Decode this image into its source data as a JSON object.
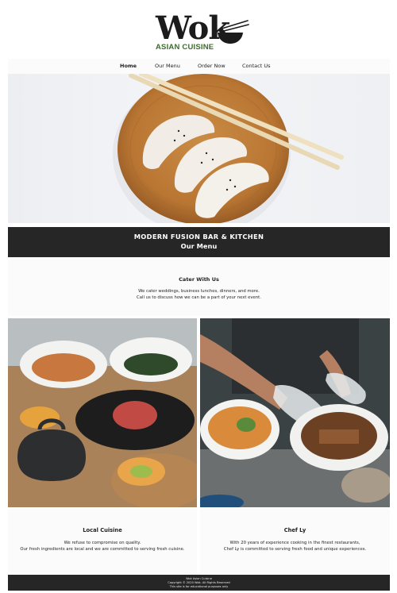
{
  "brand": {
    "name": "Wok",
    "tagline": "ASIAN CUISINE",
    "accent_color": "#3d6b2f"
  },
  "nav": {
    "items": [
      {
        "label": "Home",
        "active": true
      },
      {
        "label": "Our Menu",
        "active": false
      },
      {
        "label": "Order Now",
        "active": false
      },
      {
        "label": "Contact Us",
        "active": false
      }
    ]
  },
  "hero": {
    "image": "dumplings-on-wooden-plate-with-chopsticks"
  },
  "banner": {
    "title": "MODERN FUSION BAR & KITCHEN",
    "link": "Our Menu"
  },
  "cater": {
    "title": "Cater With Us",
    "line1": "We cater weddings, business lunches, dinners, and more.",
    "line2": "Call us to discuss how we can be a part of your next event."
  },
  "gallery": {
    "left_image": "bowls-of-asian-dishes-with-teapot",
    "right_image": "chef-plating-ramen-bowls"
  },
  "local": {
    "title": "Local Cuisine",
    "line1": "We refuse to compromise on quality.",
    "line2": "Our fresh ingredients are local and we are committed to serving fresh cuisine."
  },
  "chef": {
    "title": "Chef Ly",
    "line1": "With 20 years of experience cooking in the finest restaurants,",
    "line2": "Chef Ly is committed to serving fresh food and unique experiences."
  },
  "footer": {
    "line1": "Wok Asian Cuisine",
    "line2": "Copyright © 2020 Wok. All Rights Reserved",
    "line3": "This site is for educational purposes only"
  }
}
